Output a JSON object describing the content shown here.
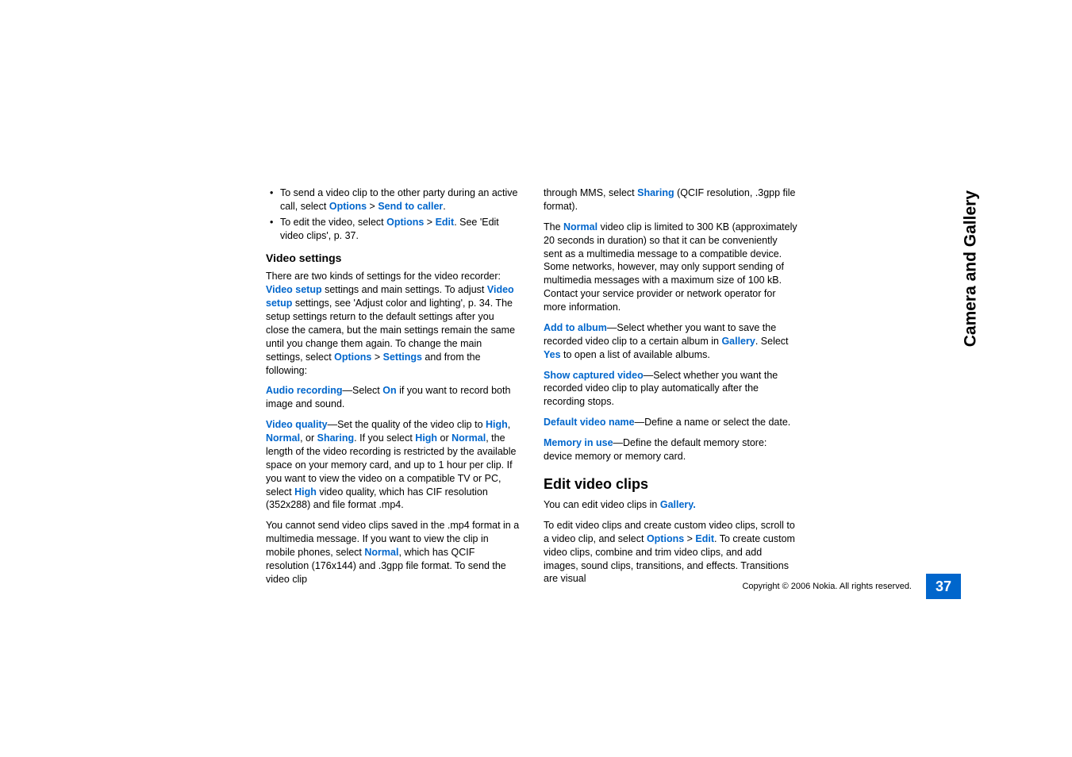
{
  "sidebar_title": "Camera and Gallery",
  "copyright": "Copyright © 2006 Nokia. All rights reserved.",
  "page_number": "37",
  "left": {
    "bullet1_a": "To send a video clip to the other party during an active call, select ",
    "bullet1_b": "Options",
    "bullet1_c": " > ",
    "bullet1_d": "Send to caller",
    "bullet1_e": ".",
    "bullet2_a": "To edit the video, select ",
    "bullet2_b": "Options",
    "bullet2_c": " > ",
    "bullet2_d": "Edit",
    "bullet2_e": ". See 'Edit video clips', p. 37.",
    "h_video_settings": "Video settings",
    "p1_a": "There are two kinds of settings for the video recorder: ",
    "p1_b": "Video setup",
    "p1_c": " settings and main settings. To adjust ",
    "p1_d": "Video setup",
    "p1_e": " settings, see 'Adjust color and lighting', p. 34. The setup settings return to the default settings after you close the camera, but the main settings remain the same until you change them again. To change the main settings, select ",
    "p1_f": "Options",
    "p1_g": " > ",
    "p1_h": "Settings",
    "p1_i": " and from the following:",
    "p2_a": "Audio recording",
    "p2_b": "—Select ",
    "p2_c": "On",
    "p2_d": " if you want to record both image and sound.",
    "p3_a": "Video quality",
    "p3_b": "—Set the quality of the video clip to ",
    "p3_c": "High",
    "p3_d": ", ",
    "p3_e": "Normal",
    "p3_f": ", or ",
    "p3_g": "Sharing",
    "p3_h": ". If you select ",
    "p3_i": "High",
    "p3_j": " or ",
    "p3_k": "Normal",
    "p3_l": ", the length of the video recording is restricted by the available space on your memory card, and up to 1 hour per clip. If you want to view the video on a compatible TV or PC, select ",
    "p3_m": "High",
    "p3_n": " video quality, which has CIF resolution (352x288) and file format .mp4.",
    "p4_a": "You cannot send video clips saved in the .mp4 format in a multimedia message. If you want to view the clip in mobile phones, select ",
    "p4_b": "Normal",
    "p4_c": ", which has QCIF resolution (176x144) and .3gpp file format. To send the video clip "
  },
  "right": {
    "p1_a": "through MMS, select ",
    "p1_b": "Sharing",
    "p1_c": " (QCIF resolution, .3gpp file format).",
    "p2_a": "The ",
    "p2_b": "Normal",
    "p2_c": " video clip is limited to 300 KB (approximately 20 seconds in duration) so that it can be conveniently sent as a multimedia message to a compatible device. Some networks, however, may only support sending of multimedia messages with a maximum size of 100 kB. Contact your service provider or network operator for more information.",
    "p3_a": "Add to album",
    "p3_b": "—Select whether you want to save the recorded video clip to a certain album in ",
    "p3_c": "Gallery",
    "p3_d": ". Select ",
    "p3_e": "Yes",
    "p3_f": " to open a list of available albums.",
    "p4_a": "Show captured video",
    "p4_b": "—Select whether you want the recorded video clip to play automatically after the recording stops.",
    "p5_a": "Default video name",
    "p5_b": "—Define a name or select the date.",
    "p6_a": "Memory in use",
    "p6_b": "—Define the default memory store: device memory or memory card.",
    "h_edit": "Edit video clips",
    "p7_a": "You can edit video clips in ",
    "p7_b": "Gallery.",
    "p8_a": "To edit video clips and create custom video clips, scroll to a video clip, and select ",
    "p8_b": "Options",
    "p8_c": " > ",
    "p8_d": "Edit",
    "p8_e": ". To create custom video clips, combine and trim video clips, and add images, sound clips, transitions, and effects. Transitions are visual "
  }
}
